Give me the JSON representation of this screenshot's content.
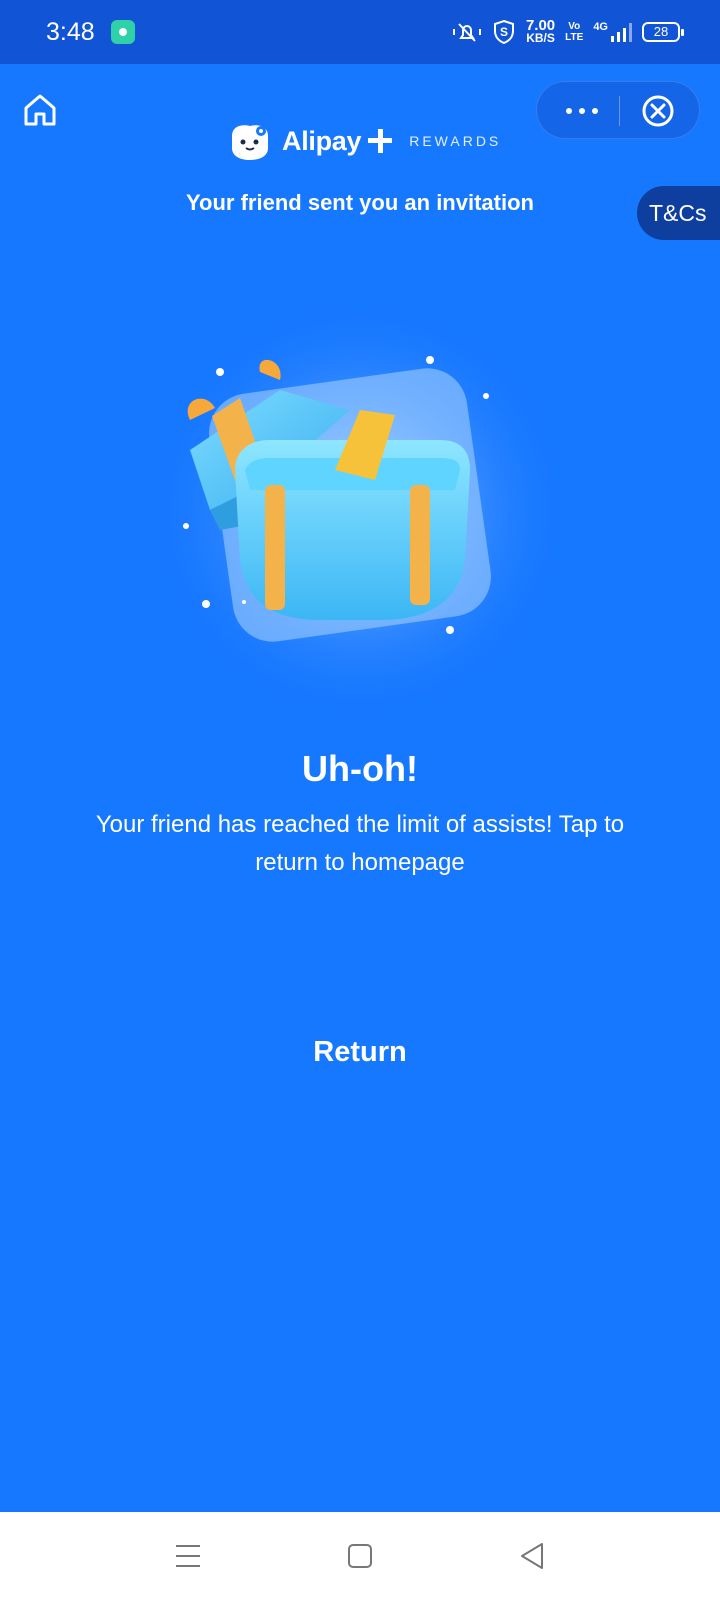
{
  "status_bar": {
    "time": "3:48",
    "net_speed_value": "7.00",
    "net_speed_unit": "KB/S",
    "volte_top": "Vo",
    "volte_bottom": "LTE",
    "network": "4G",
    "battery": "28"
  },
  "header": {
    "brand_name": "Alipay",
    "brand_suffix": "REWARDS",
    "invite_text": "Your friend sent you an invitation",
    "tcs_label": "T&Cs"
  },
  "main": {
    "title": "Uh-oh!",
    "message": "Your friend has reached the limit of assists! Tap to return to homepage",
    "return_label": "Return"
  },
  "colors": {
    "background": "#1677ff",
    "status_bar": "#1155d6",
    "tcs_tab": "#0f3f9e",
    "gift_box": "#5fd4ff",
    "gift_ribbon": "#f4b24a"
  },
  "icons": {
    "home": "home-icon",
    "more": "more-dots-icon",
    "close": "close-circle-icon",
    "nav_menu": "menu-lines-icon",
    "nav_home": "square-icon",
    "nav_back": "back-triangle-icon"
  }
}
